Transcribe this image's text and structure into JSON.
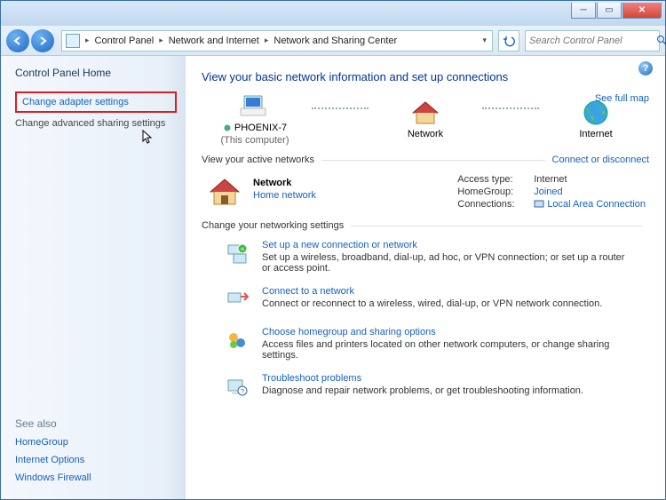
{
  "breadcrumb": {
    "seg1": "Control Panel",
    "seg2": "Network and Internet",
    "seg3": "Network and Sharing Center"
  },
  "search": {
    "placeholder": "Search Control Panel"
  },
  "sidebar": {
    "home": "Control Panel Home",
    "link1": "Change adapter settings",
    "link2": "Change advanced sharing settings",
    "seealso_hd": "See also",
    "seealso": [
      "HomeGroup",
      "Internet Options",
      "Windows Firewall"
    ]
  },
  "main": {
    "heading": "View your basic network information and set up connections",
    "fullmap": "See full map",
    "map": {
      "node1": "PHOENIX-7",
      "node1_sub": "(This computer)",
      "node2": "Network",
      "node3": "Internet"
    },
    "active_hd": "View your active networks",
    "active_link": "Connect or disconnect",
    "net": {
      "name": "Network",
      "type": "Home network",
      "access_k": "Access type:",
      "access_v": "Internet",
      "hg_k": "HomeGroup:",
      "hg_v": "Joined",
      "conn_k": "Connections:",
      "conn_v": "Local Area Connection"
    },
    "settings_hd": "Change your networking settings",
    "items": [
      {
        "title": "Set up a new connection or network",
        "desc": "Set up a wireless, broadband, dial-up, ad hoc, or VPN connection; or set up a router or access point."
      },
      {
        "title": "Connect to a network",
        "desc": "Connect or reconnect to a wireless, wired, dial-up, or VPN network connection."
      },
      {
        "title": "Choose homegroup and sharing options",
        "desc": "Access files and printers located on other network computers, or change sharing settings."
      },
      {
        "title": "Troubleshoot problems",
        "desc": "Diagnose and repair network problems, or get troubleshooting information."
      }
    ]
  }
}
